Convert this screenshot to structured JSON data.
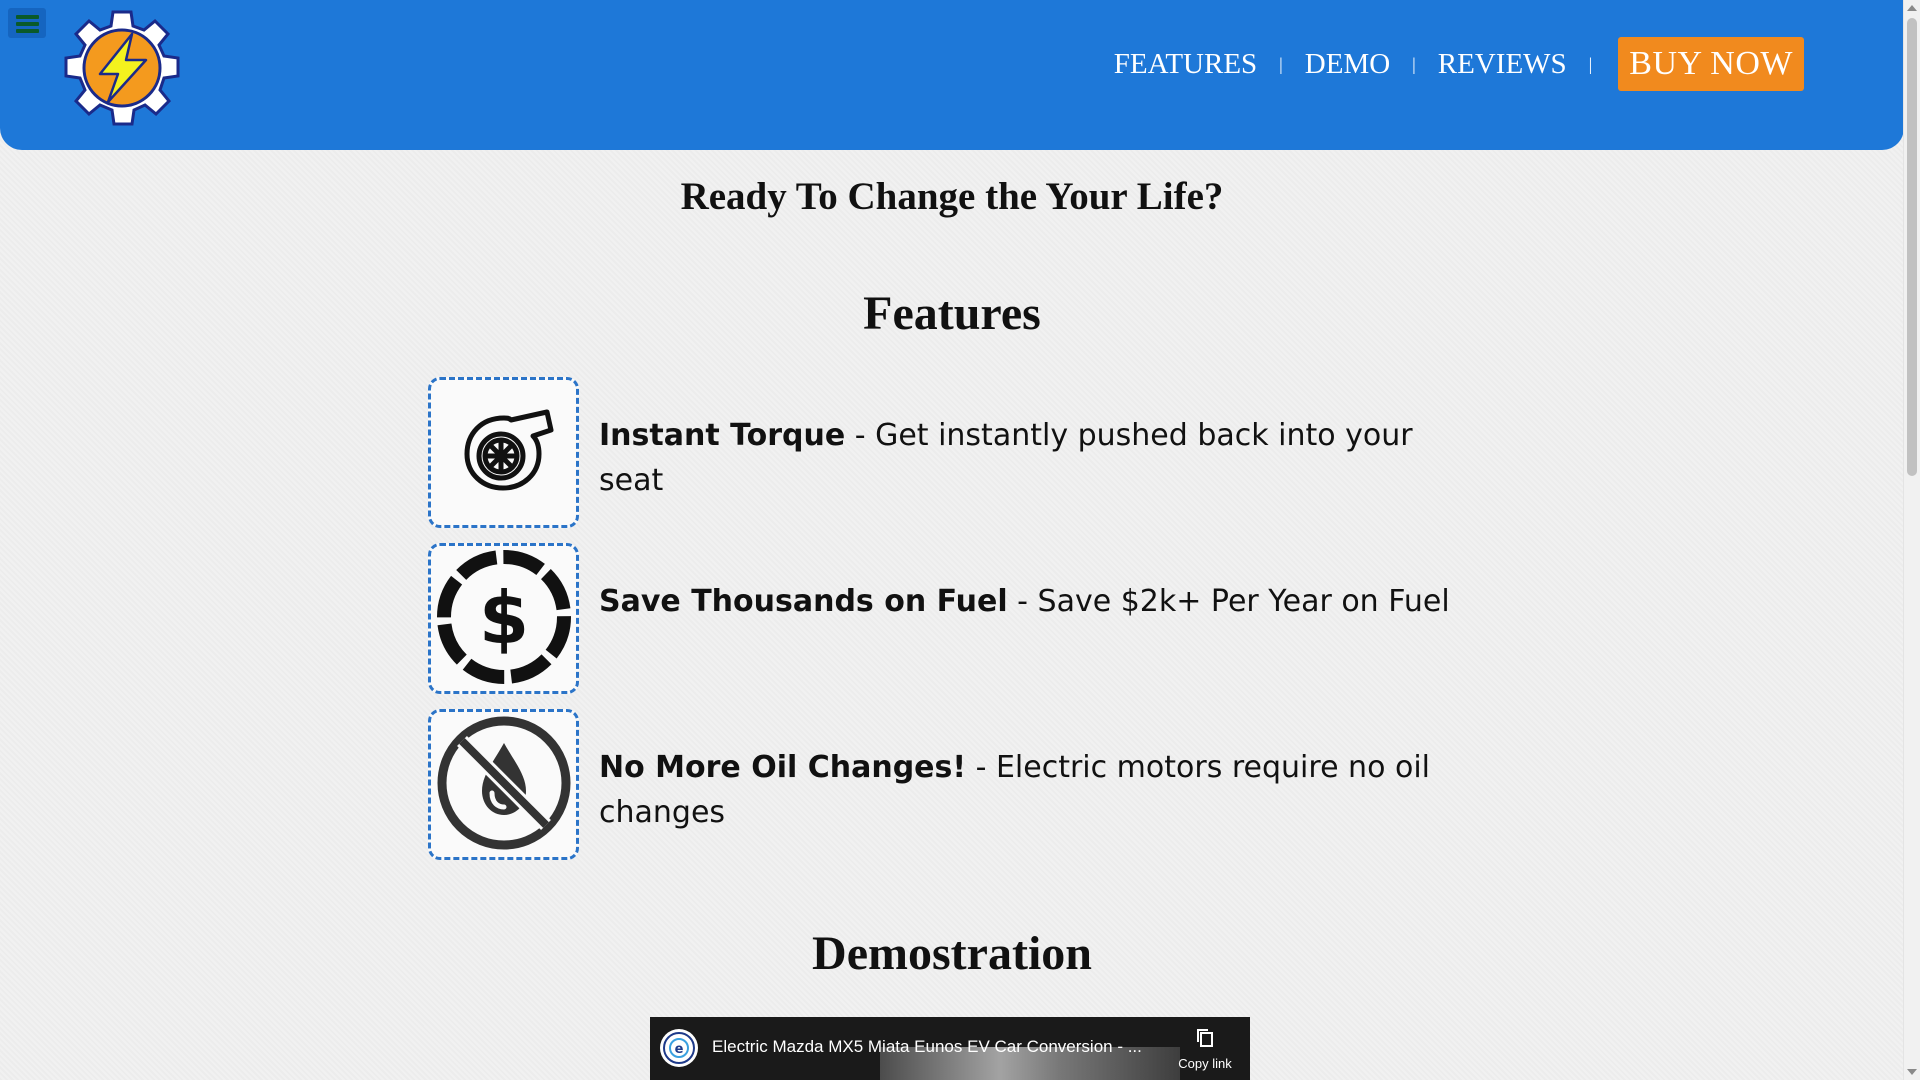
{
  "header": {
    "menu_icon": "hamburger-menu-icon",
    "logo_icon": "gear-lightning-logo",
    "nav": [
      {
        "label": "FEATURES"
      },
      {
        "label": "DEMO"
      },
      {
        "label": "REVIEWS"
      }
    ],
    "separator": "|",
    "buy_label": "BUY NOW",
    "colors": {
      "header_bg": "#1e78d8",
      "buy_bg": "#f18a1e"
    }
  },
  "hero": {
    "title": "Ready To Change the Your Life?"
  },
  "features": {
    "title": "Features",
    "items": [
      {
        "icon": "turbocharger-icon",
        "heading": "Instant Torque",
        "separator": " - ",
        "description": "Get instantly pushed back into your seat"
      },
      {
        "icon": "dollar-coin-icon",
        "heading": "Save Thousands on Fuel",
        "separator": " - ",
        "description": "Save $2k+ Per Year on Fuel"
      },
      {
        "icon": "no-oil-icon",
        "heading": "No More Oil Changes!",
        "separator": " - ",
        "description": "Electric motors require no oil changes"
      }
    ]
  },
  "demo": {
    "title": "Demostration",
    "video": {
      "title": "Electric Mazda MX5 Miata Eunos EV Car Conversion - ...",
      "copy_label": "Copy link"
    }
  }
}
